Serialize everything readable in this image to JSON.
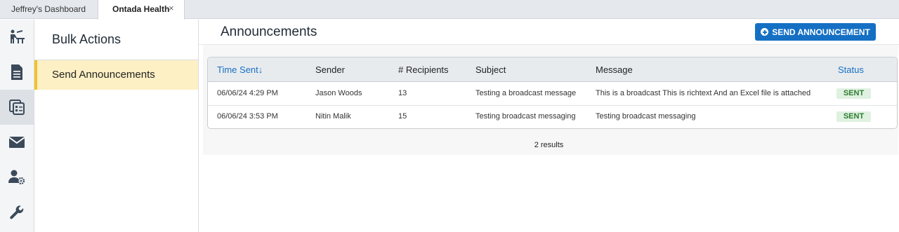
{
  "tabs": [
    {
      "label": "Jeffrey's Dashboard"
    },
    {
      "label": "Ontada Health",
      "close": "×"
    }
  ],
  "rail": {
    "items": [
      {
        "icon": "teacher-desk-icon"
      },
      {
        "icon": "document-icon"
      },
      {
        "icon": "copy-checklist-icon",
        "active": true
      },
      {
        "icon": "mail-icon"
      },
      {
        "icon": "user-settings-icon"
      },
      {
        "icon": "wrench-icon"
      }
    ]
  },
  "subnav": {
    "title": "Bulk Actions",
    "items": [
      {
        "label": "Send Announcements",
        "active": true
      }
    ]
  },
  "main": {
    "title": "Announcements",
    "send_button": "SEND ANNOUNCEMENT"
  },
  "table": {
    "columns": [
      "Time Sent",
      "Sender",
      "# Recipients",
      "Subject",
      "Message",
      "Status"
    ],
    "sort_indicator": "↓",
    "rows": [
      {
        "time": "06/06/24 4:29 PM",
        "sender": "Jason Woods",
        "recipients": "13",
        "subject": "Testing a broadcast message",
        "message": "This is a broadcast This is richtext And an Excel file is attached",
        "status": "SENT"
      },
      {
        "time": "06/06/24 3:53 PM",
        "sender": "Nitin Malik",
        "recipients": "15",
        "subject": "Testing broadcast messaging",
        "message": "Testing broadcast messaging",
        "status": "SENT"
      }
    ],
    "results_text": "2 results"
  },
  "colors": {
    "accent": "#1570c4",
    "active_nav": "#fdf0c4",
    "active_nav_border": "#f2c12e",
    "status_sent_bg": "#dff1e0",
    "status_sent_text": "#2e7d32"
  }
}
